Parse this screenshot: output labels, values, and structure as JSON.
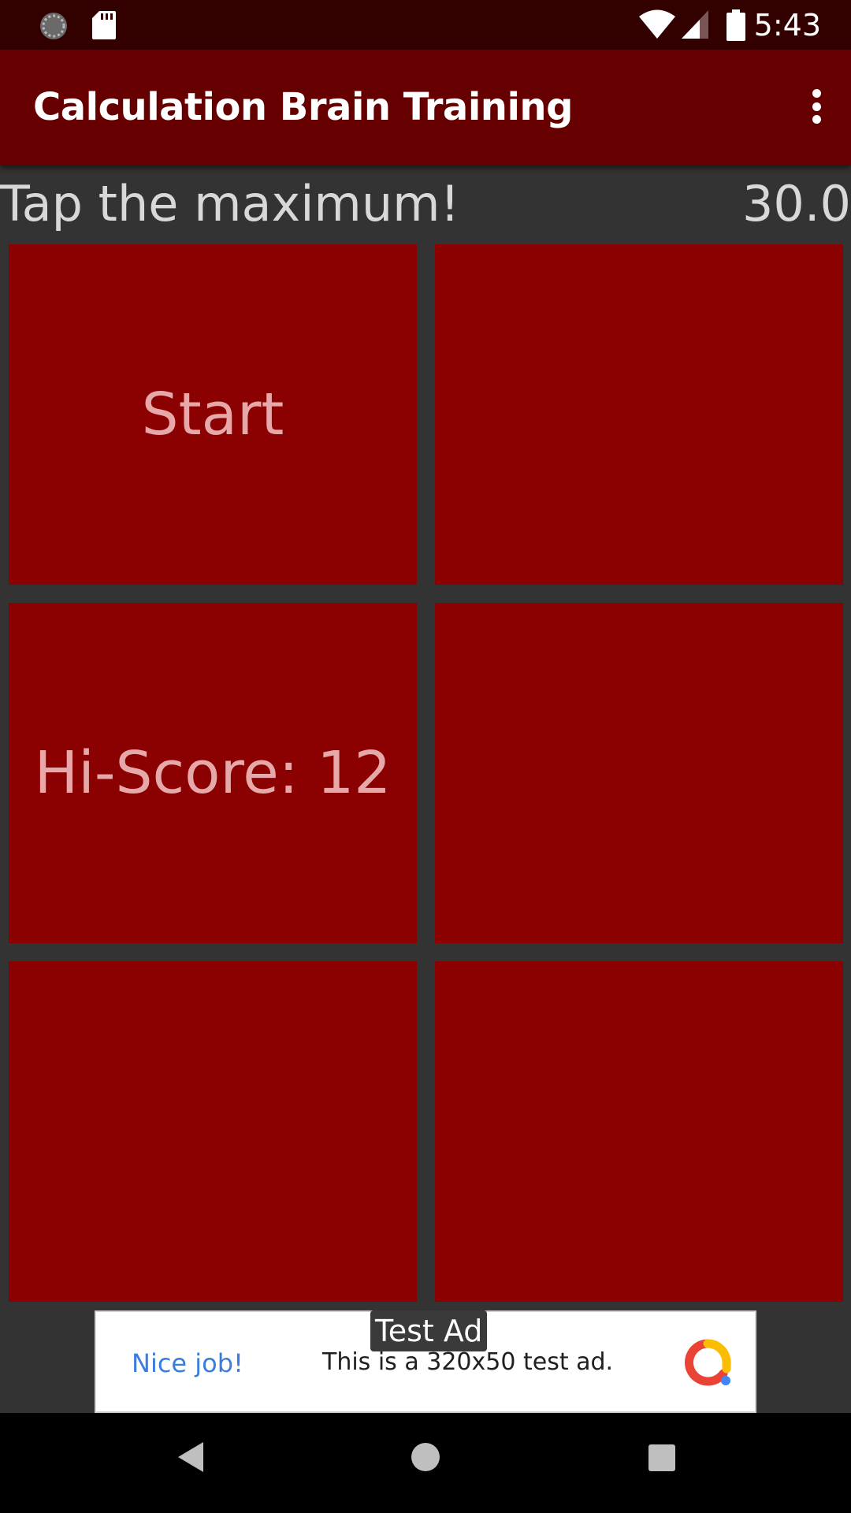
{
  "status_bar": {
    "time": "5:43",
    "icons": [
      "sync-icon",
      "sd-card-icon",
      "wifi-icon",
      "signal-icon",
      "battery-icon"
    ]
  },
  "app_bar": {
    "title": "Calculation Brain Training",
    "menu_icon": "overflow-menu-icon"
  },
  "game": {
    "instruction": "Tap the maximum!",
    "timer": "30.0",
    "cells": [
      {
        "label": "Start"
      },
      {
        "label": ""
      },
      {
        "label": "Hi-Score: 12"
      },
      {
        "label": ""
      },
      {
        "label": ""
      },
      {
        "label": ""
      }
    ]
  },
  "ad": {
    "badge": "Test Ad",
    "headline": "Nice job!",
    "body": "This is a 320x50 test ad."
  },
  "nav_bar": {
    "icons": [
      "back-icon",
      "home-icon",
      "recents-icon"
    ]
  },
  "colors": {
    "status_bar": "#330000",
    "app_bar": "#660000",
    "background": "#333333",
    "cell": "#8b0000",
    "cell_text": "#e6a8a8"
  }
}
